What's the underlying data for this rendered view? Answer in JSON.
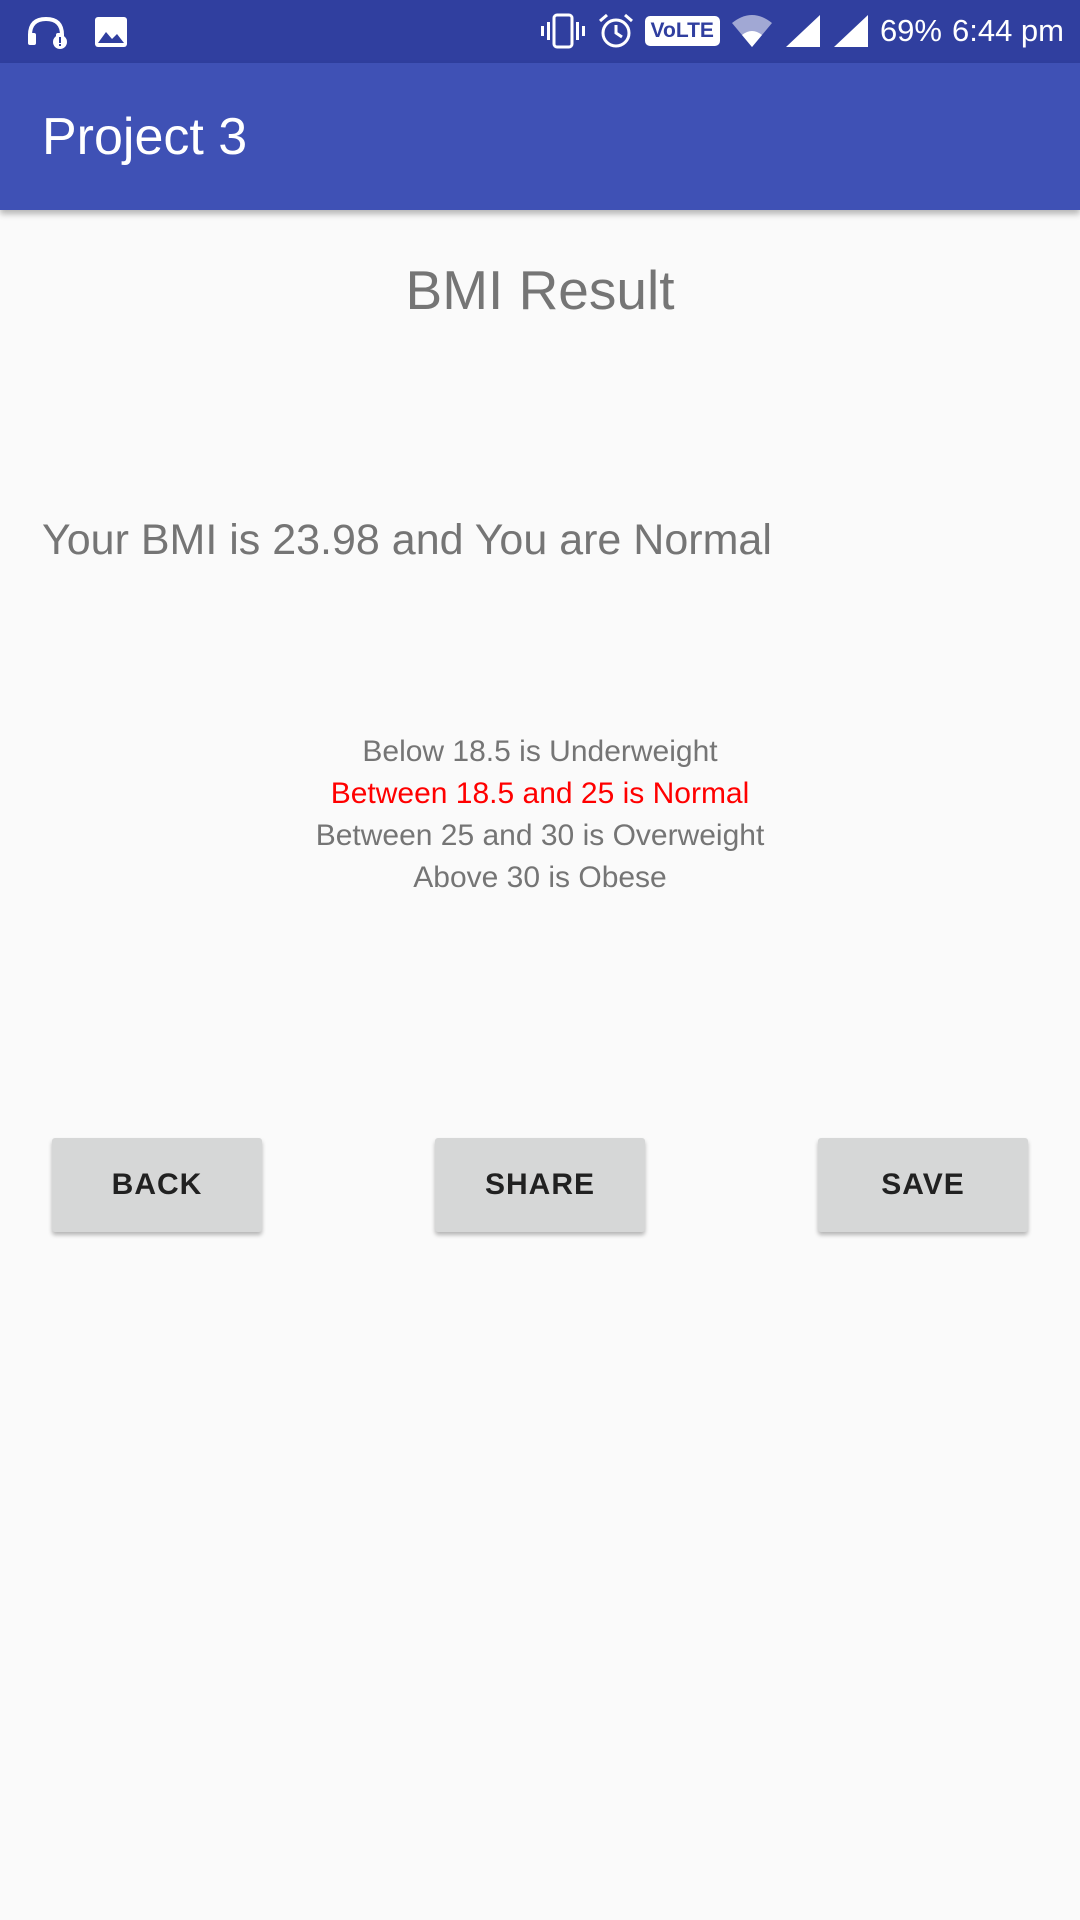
{
  "status_bar": {
    "battery": "69%",
    "time": "6:44 pm",
    "volte_label": "VoLTE",
    "icons": [
      "headset-alert-icon",
      "image-icon",
      "vibrate-icon",
      "alarm-icon",
      "volte-icon",
      "wifi-icon",
      "signal-icon",
      "signal-icon"
    ]
  },
  "app_bar": {
    "title": "Project 3"
  },
  "main": {
    "title": "BMI Result",
    "message": "Your BMI is 23.98 and You are Normal",
    "ranges": [
      {
        "text": "Below 18.5 is Underweight",
        "highlighted": false
      },
      {
        "text": "Between 18.5 and 25 is Normal",
        "highlighted": true
      },
      {
        "text": "Between 25 and 30 is Overweight",
        "highlighted": false
      },
      {
        "text": "Above 30 is Obese",
        "highlighted": false
      }
    ]
  },
  "buttons": {
    "back": "BACK",
    "share": "SHARE",
    "save": "SAVE"
  },
  "colors": {
    "status_bar": "#303f9f",
    "app_bar": "#3f51b5",
    "highlight": "#ff0000",
    "text_secondary": "#757575",
    "button_bg": "#d6d7d7"
  }
}
